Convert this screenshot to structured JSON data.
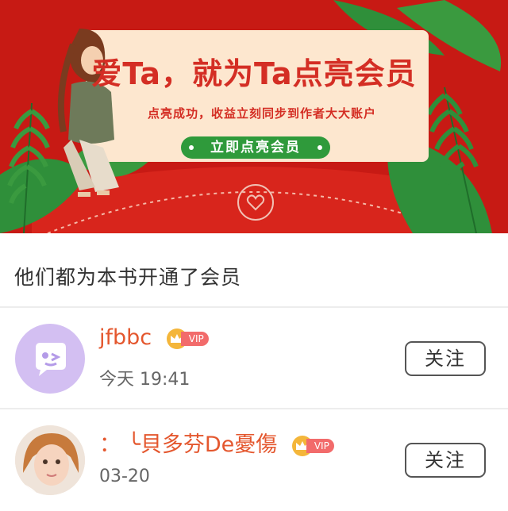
{
  "banner": {
    "headline": "爱Ta，就为Ta点亮会员",
    "subline": "点亮成功，收益立刻同步到作者大大账户",
    "cta_label": "立即点亮会员",
    "colors": {
      "background": "#c71a14",
      "card": "#fde7cf",
      "cta": "#2f9a3b",
      "leaf": "#2f8f3a"
    }
  },
  "section": {
    "title": "他们都为本书开通了会员"
  },
  "members": [
    {
      "name": "jfbbc",
      "badge": "VIP",
      "time": "今天 19:41",
      "follow_label": "关注",
      "avatar": "purple-chat-bubble-icon"
    },
    {
      "name": "：  ╰貝多芬De憂傷",
      "badge": "VIP",
      "time": "03-20",
      "follow_label": "关注",
      "avatar": "girl-photo"
    }
  ]
}
